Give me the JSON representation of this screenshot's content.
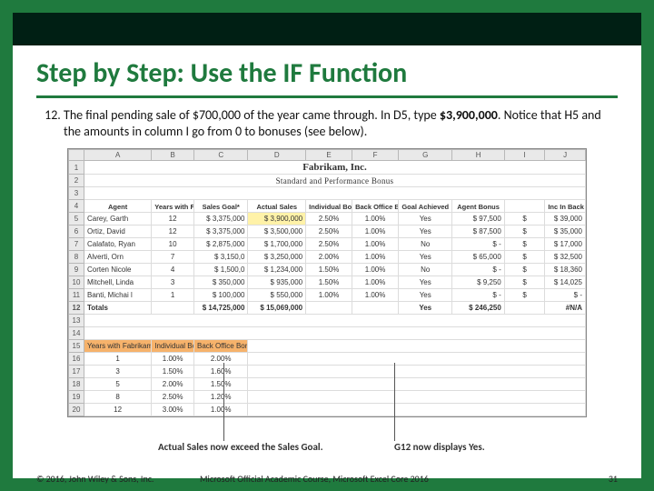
{
  "title": "Step by Step: Use the IF Function",
  "step_number_start": 12,
  "step_text_before": "The final pending sale of $700,000 of the year came through. In D5, type ",
  "step_bold": "$3,900,000",
  "step_text_after": ". Notice that H5 and the amounts in column I go from 0 to bonuses (see below).",
  "sheet": {
    "cols": [
      "",
      "A",
      "B",
      "C",
      "D",
      "E",
      "F",
      "G",
      "H",
      "I",
      "J"
    ],
    "company": "Fabrikam, Inc.",
    "subtitle": "Standard and Performance Bonus",
    "headers": {
      "agent": "Agent",
      "years": "Years with\nFabrikam",
      "goal": "Sales Goal*",
      "actual": "Actual Sales",
      "bonus_rate": "Individual\nBonus Rate",
      "back_office_rate": "Back Office\nBonus Rate",
      "goal_achieved": "Goal Achieved",
      "agent_bonus": "Agent Bonus",
      "back_office": "Inc In\nBack\nOffice"
    },
    "rows": [
      {
        "n": 5,
        "agent": "Carey, Garth",
        "years": 12,
        "goal": "$ 3,375,000",
        "actual": "$  3,900,000",
        "rate": "2.50%",
        "bo": "1.00%",
        "ach": "Yes",
        "bonus": "$   97,500",
        "back": "$   39,000"
      },
      {
        "n": 6,
        "agent": "Ortiz, David",
        "years": 12,
        "goal": "$ 3,375,000",
        "actual": "$  3,500,000",
        "rate": "2.50%",
        "bo": "1.00%",
        "ach": "Yes",
        "bonus": "$   87,500",
        "back": "$   35,000"
      },
      {
        "n": 7,
        "agent": "Calafato, Ryan",
        "years": 10,
        "goal": "$ 2,875,000",
        "actual": "$  1,700,000",
        "rate": "2.50%",
        "bo": "1.00%",
        "ach": "No",
        "bonus": "$          -",
        "back": "$   17,000"
      },
      {
        "n": 8,
        "agent": "Alverti, Orn",
        "years": 7,
        "goal": "$ 3,150,0  ",
        "actual": "$  3,250,000",
        "rate": "2.00%",
        "bo": "1.00%",
        "ach": "Yes",
        "bonus": "$   65,000",
        "back": "$   32,500"
      },
      {
        "n": 9,
        "agent": "Corten Nicole",
        "years": 4,
        "goal": "$ 1,500,0  ",
        "actual": "$  1,234,000",
        "rate": "1.50%",
        "bo": "1.00%",
        "ach": "No",
        "bonus": "$          -",
        "back": "$   18,360"
      },
      {
        "n": 10,
        "agent": "Mitchell, Linda",
        "years": 3,
        "goal": "$    350,000",
        "actual": "$     935,000",
        "rate": "1.50%",
        "bo": "1.00%",
        "ach": "Yes",
        "bonus": "$    9,250",
        "back": "$   14,025"
      },
      {
        "n": 11,
        "agent": "Banti, Michai l",
        "years": 1,
        "goal": "$    100,000",
        "actual": "$     550,000",
        "rate": "1.00%",
        "bo": "1.00%",
        "ach": "Yes",
        "bonus": "$          -",
        "back": "$           -"
      }
    ],
    "totals": {
      "n": 12,
      "label": "Totals",
      "goal": "$ 14,725,000",
      "actual": "$ 15,069,000",
      "ach": "Yes",
      "bonus": "$ 246,250",
      "back": "#N/A"
    },
    "bonus_table": {
      "header": {
        "n": 15,
        "years": "Years with Fabrikam",
        "ind": "Individual\nBonus",
        "bo": "Back Office\nBonus"
      },
      "rows": [
        {
          "n": 16,
          "y": "1",
          "ind": "1.00%",
          "bo": "2.00%"
        },
        {
          "n": 17,
          "y": "3",
          "ind": "1.50%",
          "bo": "1.60%"
        },
        {
          "n": 18,
          "y": "5",
          "ind": "2.00%",
          "bo": "1.50%"
        },
        {
          "n": 19,
          "y": "8",
          "ind": "2.50%",
          "bo": "1.20%"
        },
        {
          "n": 20,
          "y": "12",
          "ind": "3.00%",
          "bo": "1.00%"
        }
      ]
    }
  },
  "annotations": {
    "left": "Actual Sales now exceed the Sales Goal.",
    "right": "G12 now displays Yes."
  },
  "footer": {
    "copyright": "© 2016, John Wiley & Sons, Inc.",
    "course": "Microsoft Official Academic Course, Microsoft Excel Core 2016",
    "page": "31"
  }
}
